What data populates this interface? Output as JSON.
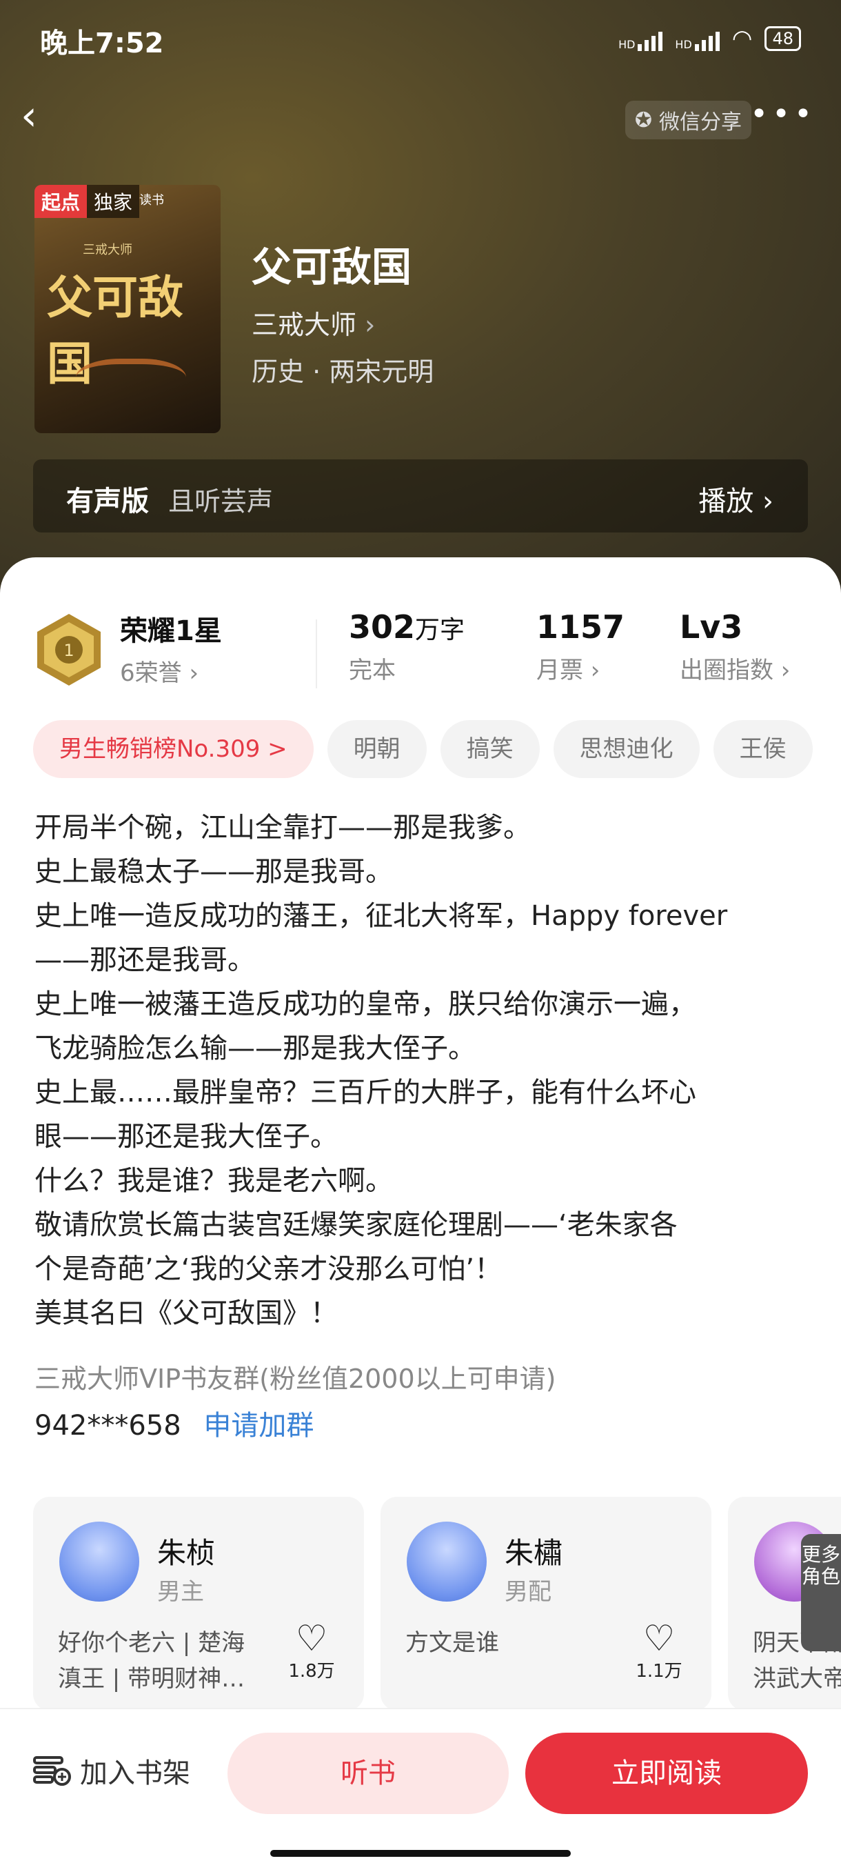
{
  "status": {
    "time": "晚上7:52",
    "hd1": "HD",
    "hd2": "HD",
    "battery": "48"
  },
  "nav": {
    "share_label": "微信分享",
    "more": "•••"
  },
  "book": {
    "title": "父可敌国",
    "author": "三戒大师",
    "genre": "历史 · 两宋元明",
    "cover_badges": [
      "起点",
      "独家",
      "读书"
    ],
    "cover_title": "父可敌国",
    "cover_author": "三戒大师"
  },
  "audio": {
    "label": "有声版",
    "narrator": "且听芸声",
    "play": "播放"
  },
  "stats": {
    "honor_title": "荣耀1星",
    "honor_sub": "6荣誉",
    "words_value": "302",
    "words_unit": "万字",
    "words_status": "完本",
    "tickets_value": "1157",
    "tickets_label": "月票",
    "index_value": "Lv3",
    "index_label": "出圈指数"
  },
  "tags": [
    "男生畅销榜No.309 >",
    "明朝",
    "搞笑",
    "思想迪化",
    "王侯"
  ],
  "description": [
    "开局半个碗，江山全靠打——那是我爹。",
    "史上最稳太子——那是我哥。",
    "史上唯一造反成功的藩王，征北大将军，Happy forever",
    "——那还是我哥。",
    "史上唯一被藩王造反成功的皇帝，朕只给你演示一遍，",
    "飞龙骑脸怎么输——那是我大侄子。",
    "史上最……最胖皇帝？三百斤的大胖子，能有什么坏心",
    "眼——那还是我大侄子。",
    "什么？我是谁？我是老六啊。",
    "敬请欣赏长篇古装宫廷爆笑家庭伦理剧——‘老朱家各",
    "个是奇葩’之‘我的父亲才没那么可怕’！",
    "美其名曰《父可敌国》！"
  ],
  "group": {
    "text": "三戒大师VIP书友群(粉丝值2000以上可申请)",
    "qq": "942***658",
    "join": "申请加群"
  },
  "characters": [
    {
      "name": "朱桢",
      "role": "男主",
      "quote": "好你个老六 | 楚海滇王 | 带明财神…",
      "likes": "1.8万"
    },
    {
      "name": "朱橚",
      "role": "男配",
      "quote": "方文是谁",
      "likes": "1.1万"
    },
    {
      "name": "",
      "role": "",
      "quote": "阴天下雨 洪武大帝",
      "likes": ""
    }
  ],
  "more_roles": "更多角色",
  "bottom": {
    "shelf": "加入书架",
    "listen": "听书",
    "read": "立即阅读"
  },
  "colors": {
    "accent": "#e8323e",
    "link": "#3a82d6"
  }
}
